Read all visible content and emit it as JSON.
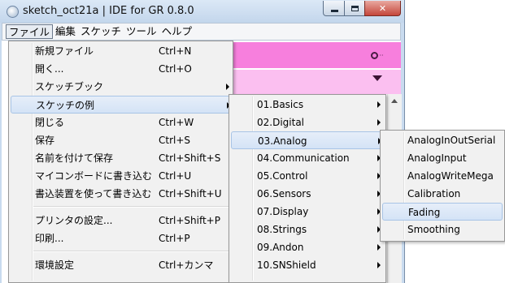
{
  "window": {
    "title": "sketch_oct21a | IDE for GR 0.8.0",
    "controls": {
      "minimize": "minimize-icon",
      "maximize": "maximize-icon",
      "close": "close-icon"
    }
  },
  "menubar": {
    "items": [
      {
        "label": "ファイル"
      },
      {
        "label": "編集"
      },
      {
        "label": "スケッチ"
      },
      {
        "label": "ツール"
      },
      {
        "label": "ヘルプ"
      }
    ]
  },
  "file_menu": {
    "items": [
      {
        "label": "新規ファイル",
        "shortcut": "Ctrl+N"
      },
      {
        "label": "開く...",
        "shortcut": "Ctrl+O"
      },
      {
        "label": "スケッチブック",
        "shortcut": ""
      },
      {
        "label": "スケッチの例",
        "shortcut": ""
      },
      {
        "label": "閉じる",
        "shortcut": "Ctrl+W"
      },
      {
        "label": "保存",
        "shortcut": "Ctrl+S"
      },
      {
        "label": "名前を付けて保存",
        "shortcut": "Ctrl+Shift+S"
      },
      {
        "label": "マイコンボードに書き込む",
        "shortcut": "Ctrl+U"
      },
      {
        "label": "書込装置を使って書き込む",
        "shortcut": "Ctrl+Shift+U"
      },
      {
        "label": "プリンタの設定...",
        "shortcut": "Ctrl+Shift+P"
      },
      {
        "label": "印刷...",
        "shortcut": "Ctrl+P"
      },
      {
        "label": "環境設定",
        "shortcut": "Ctrl+カンマ"
      }
    ]
  },
  "examples_menu": {
    "items": [
      {
        "label": "01.Basics"
      },
      {
        "label": "02.Digital"
      },
      {
        "label": "03.Analog"
      },
      {
        "label": "04.Communication"
      },
      {
        "label": "05.Control"
      },
      {
        "label": "06.Sensors"
      },
      {
        "label": "07.Display"
      },
      {
        "label": "08.Strings"
      },
      {
        "label": "09.Andon"
      },
      {
        "label": "10.SNShield"
      }
    ]
  },
  "analog_menu": {
    "items": [
      {
        "label": "AnalogInOutSerial"
      },
      {
        "label": "AnalogInput"
      },
      {
        "label": "AnalogWriteMega"
      },
      {
        "label": "Calibration"
      },
      {
        "label": "Fading"
      },
      {
        "label": "Smoothing"
      }
    ]
  },
  "toolbar": {
    "serial_monitor_icon": "serial-monitor-icon",
    "tab_menu_icon": "tab-dropdown-icon",
    "colors": {
      "toolbar": "#f77fdd",
      "tabs": "#fbbff0"
    }
  },
  "highlight": {
    "file_menu": "スケッチの例",
    "examples_menu": "03.Analog",
    "analog_menu": "Fading"
  }
}
